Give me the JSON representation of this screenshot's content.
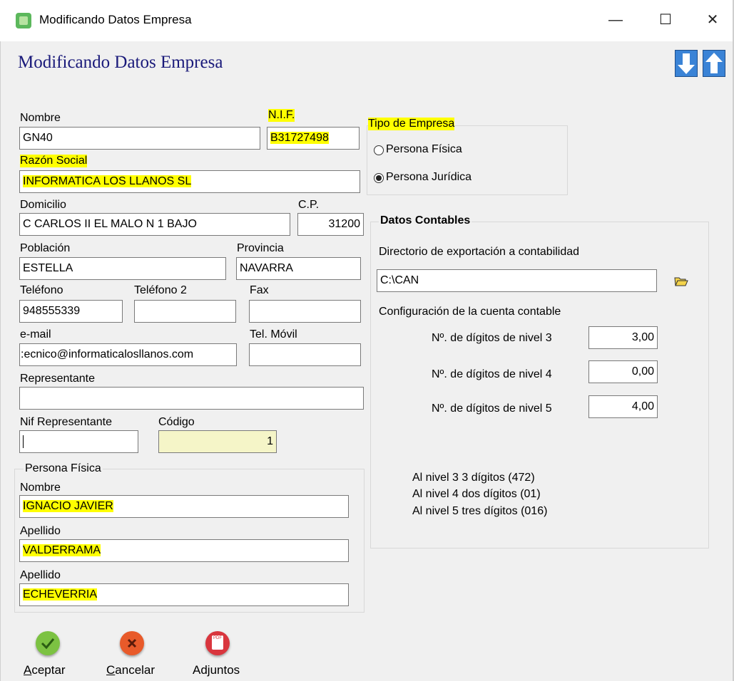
{
  "window": {
    "title": "Modificando Datos Empresa",
    "minimize": "—",
    "maximize": "☐",
    "close": "✕"
  },
  "header": {
    "title": "Modificando Datos Empresa"
  },
  "fields": {
    "nombre": {
      "label": "Nombre",
      "value": "GN40"
    },
    "nif": {
      "label": "N.I.F.",
      "value": "B31727498"
    },
    "razon_social": {
      "label": "Razón Social",
      "value": "INFORMATICA LOS LLANOS SL"
    },
    "domicilio": {
      "label": "Domicilio",
      "value": "C CARLOS II EL MALO N 1 BAJO"
    },
    "cp": {
      "label": "C.P.",
      "value": "31200"
    },
    "poblacion": {
      "label": "Población",
      "value": "ESTELLA"
    },
    "provincia": {
      "label": "Provincia",
      "value": "NAVARRA"
    },
    "telefono": {
      "label": "Teléfono",
      "value": "948555339"
    },
    "telefono2": {
      "label": "Teléfono 2",
      "value": ""
    },
    "fax": {
      "label": "Fax",
      "value": ""
    },
    "email": {
      "label": "e-mail",
      "value": ":ecnico@informaticalosllanos.com"
    },
    "tel_movil": {
      "label": "Tel. Móvil",
      "value": ""
    },
    "representante": {
      "label": "Representante",
      "value": ""
    },
    "nif_representante": {
      "label": "Nif Representante",
      "value": ""
    },
    "codigo": {
      "label": "Código",
      "value": "1"
    }
  },
  "tipo_empresa": {
    "title": "Tipo de Empresa",
    "options": [
      {
        "label": "Persona Física",
        "selected": false
      },
      {
        "label": "Persona Jurídica",
        "selected": true
      }
    ]
  },
  "persona_fisica": {
    "title": "Persona Física",
    "nombre": {
      "label": "Nombre",
      "value": "IGNACIO JAVIER"
    },
    "apellido1": {
      "label": "Apellido",
      "value": "VALDERRAMA"
    },
    "apellido2": {
      "label": "Apellido",
      "value": "ECHEVERRIA"
    }
  },
  "datos_contables": {
    "title": "Datos Contables",
    "dir_label": "Directorio de exportación a contabilidad",
    "dir_value": "C:\\CAN",
    "config_label": "Configuración de la cuenta contable",
    "niveles": [
      {
        "label": "Nº. de dígitos de nivel 3",
        "value": "3,00"
      },
      {
        "label": "Nº. de dígitos de nivel 4",
        "value": "0,00"
      },
      {
        "label": "Nº. de dígitos de nivel 5",
        "value": "4,00"
      }
    ],
    "notes": [
      "Al nivel 3 3 dígitos (472)",
      "Al nivel 4 dos dígitos (01)",
      "Al nivel 5 tres dígitos (016)"
    ]
  },
  "buttons": {
    "aceptar": {
      "first": "A",
      "rest": "ceptar"
    },
    "cancelar": {
      "first": "C",
      "rest": "ancelar"
    },
    "adjuntos": {
      "label": "Adjuntos",
      "icon_text": "PDF"
    }
  },
  "colors": {
    "highlight": "#ffff00",
    "title_blue": "#1a1a7a",
    "accept": "#7cc242",
    "cancel": "#e85a2a",
    "attach": "#d9363e"
  }
}
